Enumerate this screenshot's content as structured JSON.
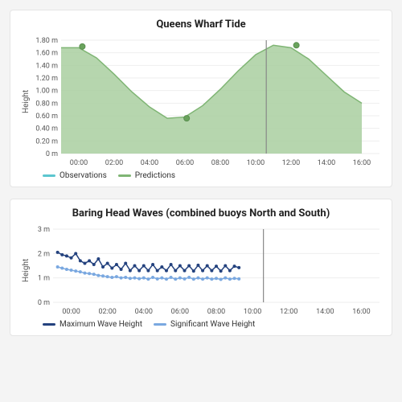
{
  "chart_data": [
    {
      "id": "tide",
      "type": "area",
      "title": "Queens Wharf Tide",
      "ylabel": "Height",
      "ylim": [
        0,
        1.8
      ],
      "yticks": [
        "0 m",
        "0.20 m",
        "0.40 m",
        "0.60 m",
        "0.80 m",
        "1.00 m",
        "1.20 m",
        "1.40 m",
        "1.60 m",
        "1.80 m"
      ],
      "xticks": [
        "00:00",
        "02:00",
        "04:00",
        "06:00",
        "08:00",
        "10:00",
        "12:00",
        "14:00",
        "16:00"
      ],
      "xlim": [
        -1,
        17
      ],
      "now_x": 10.6,
      "legend": [
        {
          "name": "Observations",
          "color": "#5cc6cf"
        },
        {
          "name": "Predictions",
          "color": "#7fb574"
        }
      ],
      "predictions_hourly": [
        1.68,
        1.68,
        1.52,
        1.26,
        0.98,
        0.74,
        0.56,
        0.58,
        0.76,
        1.02,
        1.31,
        1.57,
        1.72,
        1.68,
        1.5,
        1.24,
        0.98,
        0.8
      ],
      "markers": [
        {
          "x": 0.2,
          "y": 1.7
        },
        {
          "x": 6.1,
          "y": 0.56
        },
        {
          "x": 12.3,
          "y": 1.72
        }
      ]
    },
    {
      "id": "waves",
      "type": "line",
      "title": "Baring Head Waves (combined buoys North and South)",
      "ylabel": "Height",
      "ylim": [
        0,
        3
      ],
      "yticks": [
        "0 m",
        "1 m",
        "2 m",
        "3 m"
      ],
      "xticks": [
        "00:00",
        "02:00",
        "04:00",
        "06:00",
        "08:00",
        "10:00",
        "12:00",
        "14:00",
        "16:00"
      ],
      "xlim": [
        -1,
        17
      ],
      "now_x": 10.6,
      "legend": [
        {
          "name": "Maximum Wave Height",
          "color": "#24427e"
        },
        {
          "name": "Significant Wave Height",
          "color": "#7aa8e0"
        }
      ],
      "x": [
        -0.75,
        -0.5,
        -0.25,
        0,
        0.25,
        0.5,
        0.75,
        1,
        1.25,
        1.5,
        1.75,
        2,
        2.25,
        2.5,
        2.75,
        3,
        3.25,
        3.5,
        3.75,
        4,
        4.25,
        4.5,
        4.75,
        5,
        5.25,
        5.5,
        5.75,
        6,
        6.25,
        6.5,
        6.75,
        7,
        7.25,
        7.5,
        7.75,
        8,
        8.25,
        8.5,
        8.75,
        9,
        9.25
      ],
      "series": [
        {
          "name": "Maximum Wave Height",
          "values": [
            2.05,
            1.95,
            1.9,
            1.82,
            2.0,
            1.7,
            1.6,
            1.7,
            1.55,
            1.78,
            1.45,
            1.6,
            1.4,
            1.55,
            1.35,
            1.6,
            1.3,
            1.5,
            1.3,
            1.5,
            1.3,
            1.55,
            1.3,
            1.45,
            1.3,
            1.55,
            1.3,
            1.5,
            1.3,
            1.5,
            1.28,
            1.52,
            1.3,
            1.5,
            1.3,
            1.48,
            1.28,
            1.5,
            1.3,
            1.48,
            1.42
          ]
        },
        {
          "name": "Significant Wave Height",
          "values": [
            1.45,
            1.4,
            1.35,
            1.32,
            1.28,
            1.25,
            1.2,
            1.18,
            1.15,
            1.1,
            1.08,
            1.05,
            1.02,
            1.05,
            1.0,
            1.02,
            0.98,
            1.0,
            0.97,
            1.0,
            0.95,
            1.02,
            0.96,
            1.0,
            0.95,
            1.02,
            0.95,
            1.0,
            0.96,
            1.02,
            0.95,
            1.0,
            0.95,
            1.0,
            0.95,
            0.98,
            0.94,
            1.0,
            0.95,
            0.98,
            0.96
          ]
        }
      ]
    }
  ]
}
